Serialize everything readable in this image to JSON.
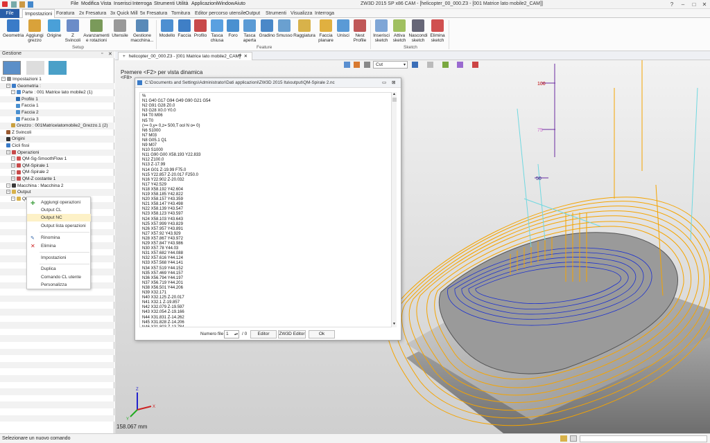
{
  "window": {
    "title": "ZW3D 2015 SP x86        CAM - [helicopter_00_000.Z3 - [001 Matrice lato mobile2_CAM]]"
  },
  "menu": [
    "File",
    "Modifica",
    "Vista",
    "Inserisci",
    "Interroga",
    "Strumenti",
    "Utilità",
    "Applicazioni",
    "Window",
    "Aiuto"
  ],
  "ribbon_tabs": [
    "File",
    "Impostazioni",
    "Foratura",
    "2x Fresatura",
    "3x Quick Mill",
    "5x Fresatura",
    "Tornitura",
    "Editor percorso utensile",
    "Output",
    "Strumenti",
    "Visualizza",
    "Interroga"
  ],
  "ribbon": {
    "setup": [
      "Geometria",
      "Aggiungi grezzo",
      "Origine",
      "Z Svincoli",
      "Avanzamenti e rotazioni",
      "Utensile",
      "Gestione macchina..."
    ],
    "feature": [
      "Modello",
      "Faccia",
      "Profilo",
      "Tasca chiusa",
      "Foro",
      "Tasca aperta",
      "Gradino",
      "Smusso",
      "Raggiatura",
      "Faccia planare",
      "Unisci",
      "Nest Profile"
    ],
    "sketch": [
      "Inserisci sketch",
      "Attiva sketch",
      "Nascondi sketch",
      "Elimina sketch"
    ],
    "group_labels": [
      "Setup",
      "Feature",
      "Sketch"
    ]
  },
  "panel": {
    "title": "Gestione"
  },
  "tree": [
    "Impostazioni 1",
    "Geometria :",
    "Parte : 001 Matrice lato mobile2 (1)",
    "Profilo 1",
    "Faccia 1",
    "Faccia 2",
    "Faccia 3",
    "Grezzo : 001Matricelatomobile2_Grezzo.1 (2)",
    "Z Svincoli",
    "Origini",
    "Cicli fissi",
    "Operazioni",
    "QM-Sg-SmoothFlow 1",
    "QM-Spirale 1",
    "QM-Spirale 2",
    "QM-Z costante 1",
    "Macchina : Macchina 2",
    "Output",
    "QM"
  ],
  "context_menu": [
    "Aggiungi operazioni",
    "Output CL",
    "Output NC",
    "Output lista operazioni",
    "Rinomina",
    "Elimina",
    "Impostazioni",
    "Duplica",
    "Comando CL utente",
    "Personalizza"
  ],
  "doc_tab": "helicopter_00_000.Z3 - [001 Matrice lato mobile2_CAM]",
  "view_combo": "Cut",
  "hints": [
    "Premere <F2> per vista dinamica",
    "<F8>"
  ],
  "measure": "158.067 mm",
  "axis_labels": [
    "100",
    "75",
    "50"
  ],
  "nc_window": {
    "title": "C:\\Documents and Settings\\Administrator\\Dati applicazioni\\ZW3D 2015 Ita\\output\\QM-Spirale 2.nc",
    "lines": [
      "%",
      "N1 G40 G17 G94 G49 G90 G21 G54",
      "N2 G91 G28 Z0.0",
      "N3 G28 X0.0 Y0.0",
      "N4 T0 M06",
      "N5 T0",
      "(>= 0,y= 0,z= 500,T ool N o= 0)",
      "N6 S1000",
      "N7 M03",
      "N8 G05.1 Q1",
      "N9 M07",
      "N10 S1000",
      "N11 G90 G00 X58.193 Y22.833",
      "N12 Z100.0",
      "N13 Z-17.99",
      "N14 G01 Z-19.99 F75.0",
      "N15 Y22.857 Z-20.017 F250.0",
      "N16 Y22.902 Z-20.032",
      "N17 Y42.529",
      "N18 X58.192 Y42.604",
      "N19 X58.185 Y42.822",
      "N20 X58.157 Y43.359",
      "N21 X58.147 Y43.498",
      "N22 X58.139 Y43.547",
      "N23 X58.123 Y43.597",
      "N24 X58.103 Y43.643",
      "N25 X57.999 Y43.829",
      "N26 X57.957 Y43.891",
      "N27 X57.92 Y43.929",
      "N28 X57.867 Y43.972",
      "N29 X57.847 Y43.986",
      "N30 X57.78 Y44.03",
      "N31 X57.682 Y44.088",
      "N32 X57.616 Y44.124",
      "N33 X57.568 Y44.141",
      "N34 X57.519 Y44.152",
      "N35 X57.469 Y44.157",
      "N36 X56.794 Y44.197",
      "N37 X56.719 Y44.201",
      "N38 X56.501 Y44.206",
      "N39 X32.171",
      "N40 X32.125 Z-20.017",
      "N41 X32.1 Z-19.857",
      "N42 X32.079 Z-19.597",
      "N43 X32.054 Z-19.166",
      "N44 X31.831 Z-14.262",
      "N45 X31.828 Z-14.206",
      "N46 X31.803 Z-13.784"
    ],
    "file_label": "Numero file",
    "file_value": "1",
    "file_total": "/ 0",
    "editor": "Editor",
    "zw3d_editor": "ZW3D Editor",
    "ok": "Ok"
  },
  "status": "Selezionare un nuovo comando"
}
